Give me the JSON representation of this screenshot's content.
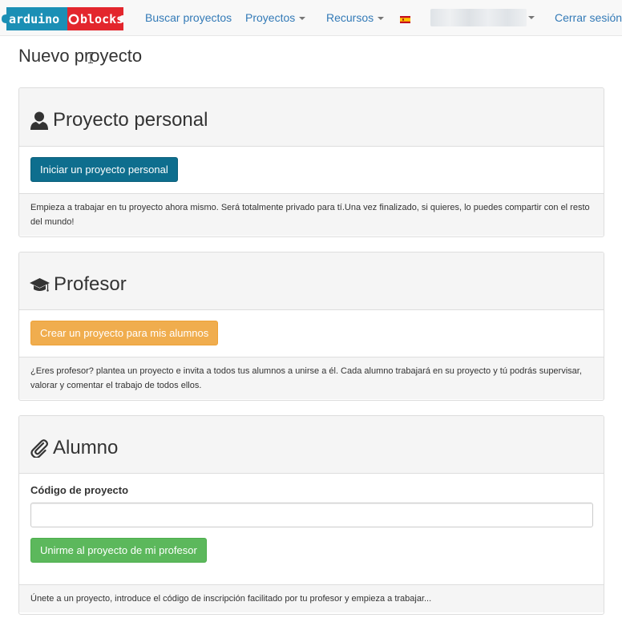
{
  "navbar": {
    "logo_text_left": "arduino",
    "logo_text_right": "blocks",
    "links": [
      {
        "label": "Buscar proyectos"
      },
      {
        "label": "Proyectos"
      },
      {
        "label": "Recursos"
      }
    ],
    "language_icon": "spain-flag-icon",
    "logout_label": "Cerrar sesión"
  },
  "page": {
    "title": "Nuevo proyecto"
  },
  "panels": {
    "personal": {
      "icon": "user-icon",
      "title": "Proyecto personal",
      "button_label": "Iniciar un proyecto personal",
      "footer_text": "Empieza a trabajar en tu proyecto ahora mismo. Será totalmente privado para tí.Una vez finalizado, si quieres, lo puedes compartir con el resto del mundo!"
    },
    "teacher": {
      "icon": "graduation-cap-icon",
      "title": "Profesor",
      "button_label": "Crear un proyecto para mis alumnos",
      "footer_text": "¿Eres profesor? plantea un proyecto e invita a todos tus alumnos a unirse a él. Cada alumno trabajará en su proyecto y tú podrás supervisar, valorar y comentar el trabajo de todos ellos."
    },
    "student": {
      "icon": "paperclip-icon",
      "title": "Alumno",
      "field_label": "Código de proyecto",
      "field_value": "",
      "button_label": "Unirme al proyecto de mi profesor",
      "footer_text": "Únete a un proyecto, introduce el código de inscripción facilitado por tu profesor y empieza a trabajar..."
    }
  },
  "colors": {
    "link": "#337ab7",
    "primary_button": "#0e6e8e",
    "warning_button": "#f0ad4e",
    "success_button": "#5cb85c",
    "logo_blue": "#1b8fb5",
    "logo_red": "#e3262d"
  }
}
